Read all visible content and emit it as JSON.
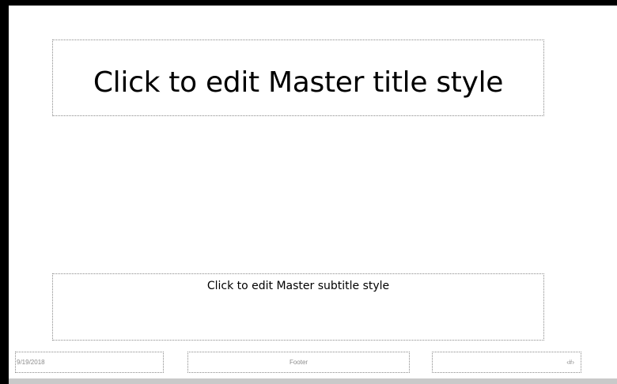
{
  "slide_master": {
    "title_placeholder": "Click to edit Master title style",
    "subtitle_placeholder": "Click to edit Master subtitle style",
    "footer": {
      "date": "9/19/2018",
      "footer_text": "Footer",
      "slide_number": "‹#›"
    }
  },
  "colors": {
    "frame": "#000000",
    "placeholder_border": "#8a8a8a",
    "footer_text": "#8c8c8c",
    "slide_background": "#ffffff"
  }
}
